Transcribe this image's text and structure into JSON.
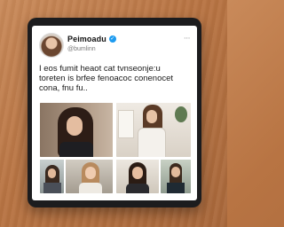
{
  "post": {
    "display_name": "Peimoadu",
    "handle": "@bumlinn",
    "text_lines": [
      "I eos fumit heaot cat tvnseonje:u",
      "toreten is brfee fenoacoc conenocet",
      "cona, fnu fu.."
    ]
  },
  "icons": {
    "verified": "verified-badge-icon",
    "more": "more-options-icon"
  },
  "colors": {
    "verified_badge": "#1d9bf0",
    "screen_background": "#ffffff",
    "tablet_frame": "#1c1c1e"
  }
}
